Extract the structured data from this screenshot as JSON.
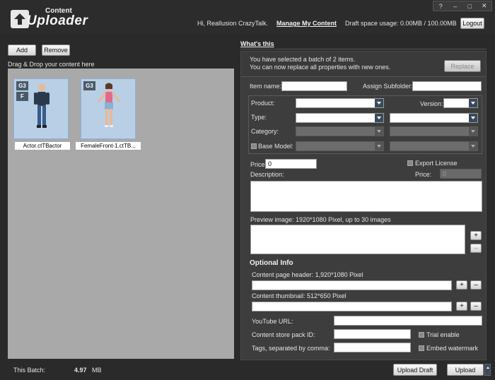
{
  "header": {
    "logo_small": "Content",
    "logo_big": "Uploader",
    "greeting": "Hi, Reallusion CrazyTalk.",
    "manage_link": "Manage My Content",
    "draft_usage": "Draft space usage: 0.00MB / 100.00MB",
    "logout_label": "Logout",
    "window_controls": [
      "?",
      "–",
      "□",
      "✕"
    ]
  },
  "left": {
    "add_label": "Add",
    "remove_label": "Remove",
    "drag_hint": "Drag & Drop your content here",
    "items": [
      {
        "name": "Actor.ctTBactor",
        "badges": [
          "G3",
          "F"
        ]
      },
      {
        "name": "FemaleFront-1.ctTB...",
        "badges": [
          "G3"
        ]
      }
    ]
  },
  "whats_this": "What's this",
  "batch_notice": {
    "line1": "You have selected a batch of 2 items.",
    "line2": "You can now replace all properties with new ones.",
    "replace_label": "Replace"
  },
  "form": {
    "item_name_label": "Item name:",
    "subfolder_label": "Assign Subfolder:",
    "product_label": "Product:",
    "version_label": "Version:",
    "type_label": "Type:",
    "category_label": "Category:",
    "base_model_label": "Base Model:",
    "price_label": "Price:",
    "price_value": "0",
    "export_license_label": "Export License",
    "price2_label": "Price:",
    "price2_value": "0",
    "description_label": "Description:",
    "preview_label": "Preview image: 1920*1080 Pixel, up to 30 images"
  },
  "optional": {
    "title": "Optional Info",
    "header_label": "Content page header: 1,920*1080 Pixel",
    "thumb_label": "Content thumbnail: 512*650 Pixel",
    "youtube_label": "YouTube URL:",
    "pack_id_label": "Content store pack ID:",
    "trial_label": "Trial enable",
    "tags_label": "Tags, separated by comma:",
    "watermark_label": "Embed watermark"
  },
  "footer": {
    "batch_label": "This Batch:",
    "batch_size": "4.97",
    "batch_unit": "MB",
    "upload_draft_label": "Upload Draft",
    "upload_label": "Upload"
  }
}
